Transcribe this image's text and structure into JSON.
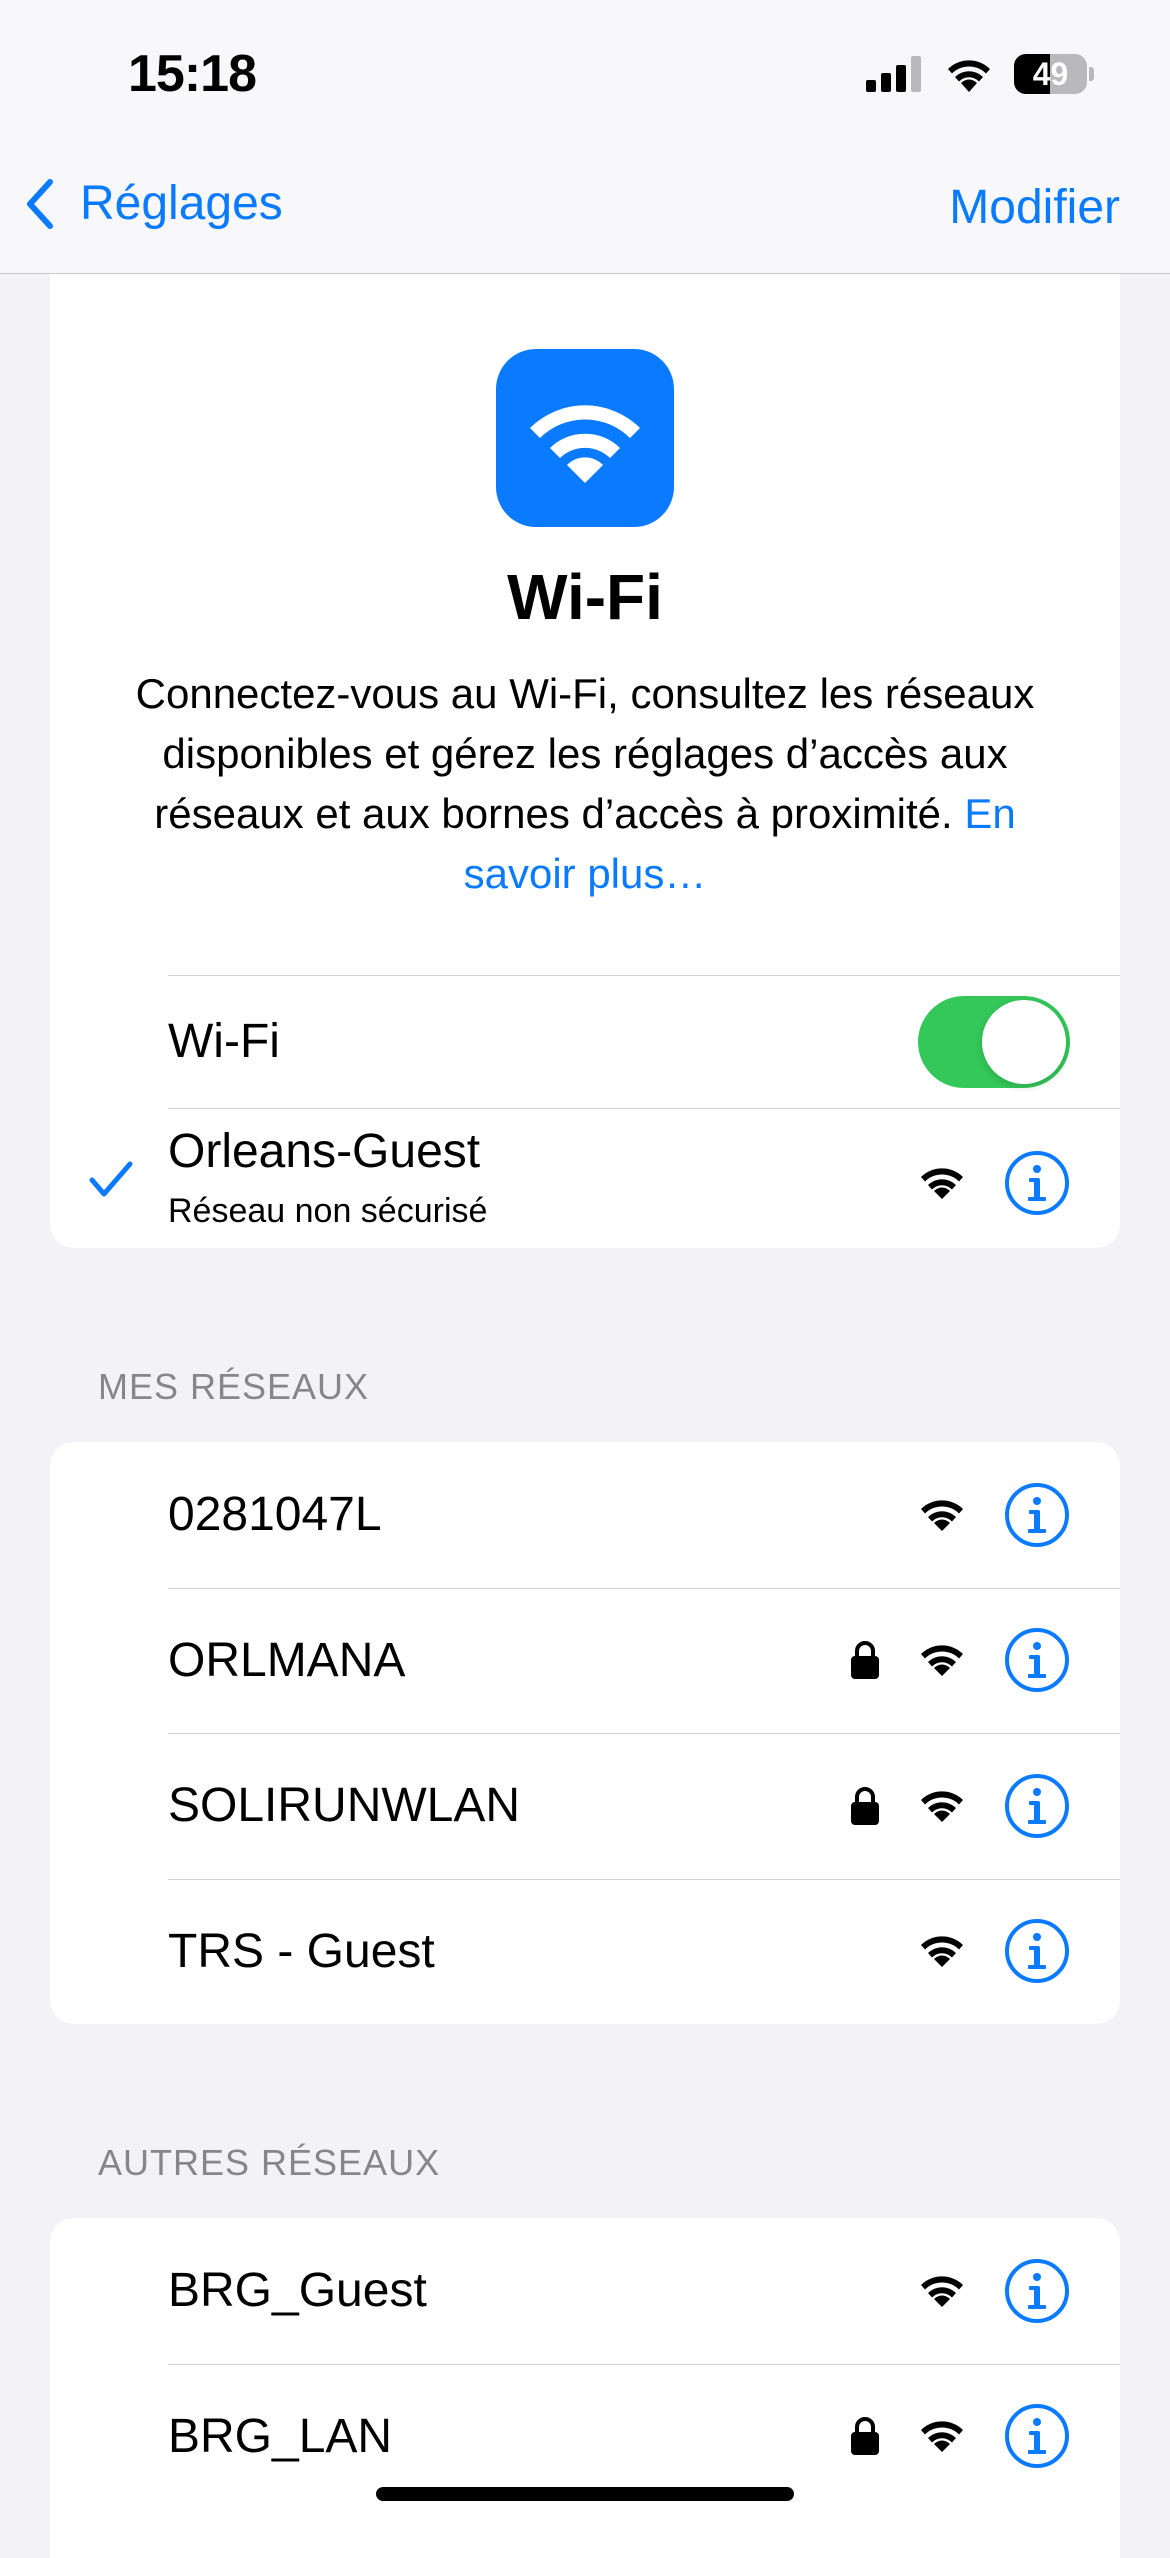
{
  "status_bar": {
    "time": "15:18",
    "battery_level": "49",
    "battery_fraction": 0.49
  },
  "nav": {
    "back_label": "Réglages",
    "edit_label": "Modifier"
  },
  "hero": {
    "title": "Wi-Fi",
    "description": "Connectez-vous au Wi-Fi, consultez les réseaux disponibles et gérez les réglages d’accès aux réseaux et aux bornes d’accès à proximité.",
    "learn_more": "En savoir plus…"
  },
  "wifi_toggle": {
    "label": "Wi-Fi",
    "state": "on"
  },
  "connected": {
    "name": "Orleans-Guest",
    "status": "Réseau non sécurisé"
  },
  "my_networks": {
    "header": "MES RÉSEAUX",
    "items": [
      {
        "name": "0281047L",
        "locked": false
      },
      {
        "name": "ORLMANA",
        "locked": true
      },
      {
        "name": "SOLIRUNWLAN",
        "locked": true
      },
      {
        "name": "TRS - Guest",
        "locked": false
      }
    ]
  },
  "other_networks": {
    "header": "AUTRES RÉSEAUX",
    "items": [
      {
        "name": "BRG_Guest",
        "locked": false
      },
      {
        "name": "BRG_LAN",
        "locked": true
      }
    ]
  },
  "colors": {
    "accent": "#0a7aff",
    "toggle_on": "#34c759",
    "background": "#f2f2f7",
    "section_header": "#86868b"
  },
  "icons": {
    "check": "checkmark-icon",
    "wifi": "wifi-signal-icon",
    "lock": "lock-icon",
    "info": "info-circle-icon",
    "back": "chevron-left-icon"
  }
}
